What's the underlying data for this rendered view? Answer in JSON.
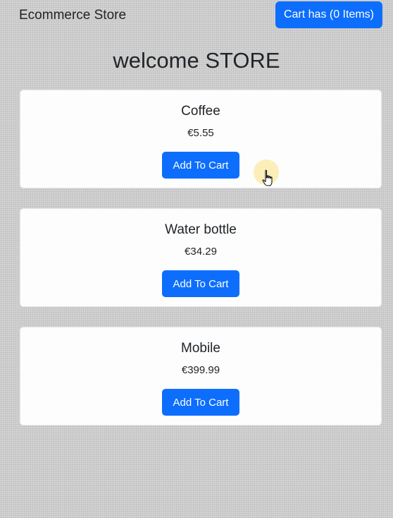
{
  "navbar": {
    "brand": "Ecommerce Store",
    "cart_button_label": "Cart has (0 Items)"
  },
  "page": {
    "title": "welcome STORE"
  },
  "products": [
    {
      "name": "Coffee",
      "price": "€5.55",
      "button_label": "Add To Cart"
    },
    {
      "name": "Water bottle",
      "price": "€34.29",
      "button_label": "Add To Cart"
    },
    {
      "name": "Mobile",
      "price": "€399.99",
      "button_label": "Add To Cart"
    }
  ],
  "colors": {
    "primary": "#0d6efd",
    "card_background": "#fdfdfd",
    "page_background": "#d4d4d4"
  },
  "cursor": {
    "icon": "hand-pointer-icon"
  }
}
